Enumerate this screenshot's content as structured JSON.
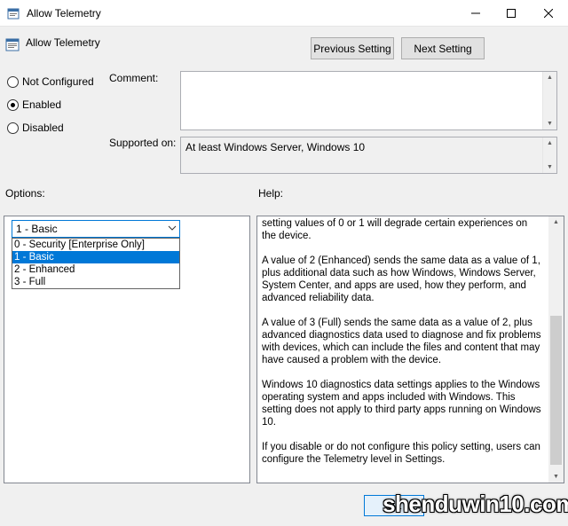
{
  "window": {
    "title": "Allow Telemetry",
    "icon": "policy-icon",
    "controls": [
      "minimize-icon",
      "maximize-icon",
      "close-icon"
    ]
  },
  "header": {
    "title": "Allow Telemetry",
    "prev_label": "Previous Setting",
    "next_label": "Next Setting"
  },
  "state": {
    "options": [
      {
        "label": "Not Configured",
        "checked": false
      },
      {
        "label": "Enabled",
        "checked": true
      },
      {
        "label": "Disabled",
        "checked": false
      }
    ]
  },
  "comment": {
    "label": "Comment:",
    "value": ""
  },
  "supported": {
    "label": "Supported on:",
    "value": "At least Windows Server, Windows 10"
  },
  "options_section": {
    "label": "Options:",
    "dropdown": {
      "selected": "1 - Basic",
      "items": [
        "0 - Security [Enterprise Only]",
        "1 - Basic",
        "2 - Enhanced",
        "3 - Full"
      ]
    }
  },
  "help": {
    "label": "Help:",
    "paragraphs": [
      "setting values of 0 or 1 will degrade certain experiences on the device.",
      "A value of 2 (Enhanced) sends the same data as a value of 1, plus additional data such as how Windows, Windows Server, System Center, and apps are used, how they perform, and advanced reliability data.",
      "A value of 3 (Full) sends the same data as a value of 2, plus advanced diagnostics data used to diagnose and fix problems with devices, which can include the files and content that may have caused a problem with the device.",
      "Windows 10 diagnostics data settings applies to the Windows operating system and apps included with Windows. This setting does not apply to third party apps running on Windows 10.",
      "If you disable or do not configure this policy setting, users can configure the Telemetry level in Settings."
    ]
  },
  "footer": {
    "ok_label": "OK"
  },
  "watermark": "shenduwin10.com"
}
